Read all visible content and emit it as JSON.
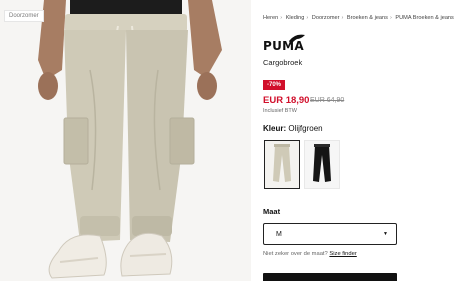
{
  "image": {
    "season_tag": "Doorzomer"
  },
  "breadcrumb": [
    "Heren",
    "Kleding",
    "Doorzomer",
    "Broeken & jeans",
    "PUMA Broeken & jeans"
  ],
  "product": {
    "brand": "PUMA",
    "title": "Cargobroek",
    "discount_badge": "-70%",
    "price_now": "EUR 18,90",
    "price_was": "EUR 64,90",
    "vat_note": "Inclusief BTW"
  },
  "colors": {
    "label": "Kleur:",
    "selected": "Olijfgroen",
    "swatches": [
      "olijfgroen",
      "zwart"
    ]
  },
  "size": {
    "label": "Maat",
    "selected": "M",
    "help_text": "Niet zeker over de maat?",
    "help_link": "Size finder"
  },
  "theme": {
    "sale_red": "#d10f2b",
    "ink": "#111111",
    "pant_beige": "#cfcab7"
  }
}
